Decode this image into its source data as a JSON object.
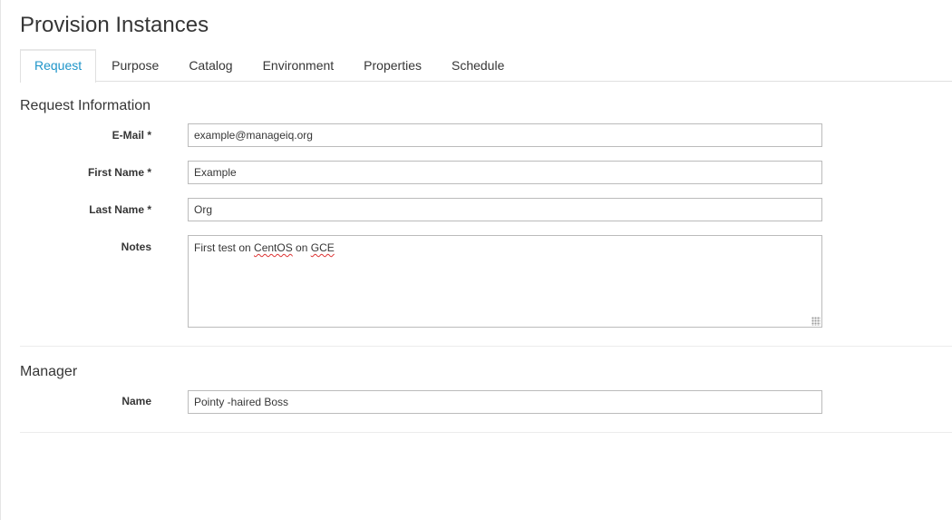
{
  "page": {
    "title": "Provision Instances"
  },
  "tabs": [
    {
      "label": "Request",
      "active": true
    },
    {
      "label": "Purpose",
      "active": false
    },
    {
      "label": "Catalog",
      "active": false
    },
    {
      "label": "Environment",
      "active": false
    },
    {
      "label": "Properties",
      "active": false
    },
    {
      "label": "Schedule",
      "active": false
    }
  ],
  "request_info": {
    "title": "Request Information",
    "email": {
      "label": "E-Mail *",
      "value": "example@manageiq.org"
    },
    "first_name": {
      "label": "First Name *",
      "value": "Example"
    },
    "last_name": {
      "label": "Last Name *",
      "value": "Org"
    },
    "notes": {
      "label": "Notes",
      "parts": [
        "First test on ",
        "CentOS",
        " on ",
        "GCE"
      ]
    }
  },
  "manager": {
    "title": "Manager",
    "name": {
      "label": "Name",
      "value": "Pointy -haired Boss"
    }
  },
  "colors": {
    "accent": "#1f95c9",
    "text": "#363636",
    "border": "#bbbbbb"
  }
}
